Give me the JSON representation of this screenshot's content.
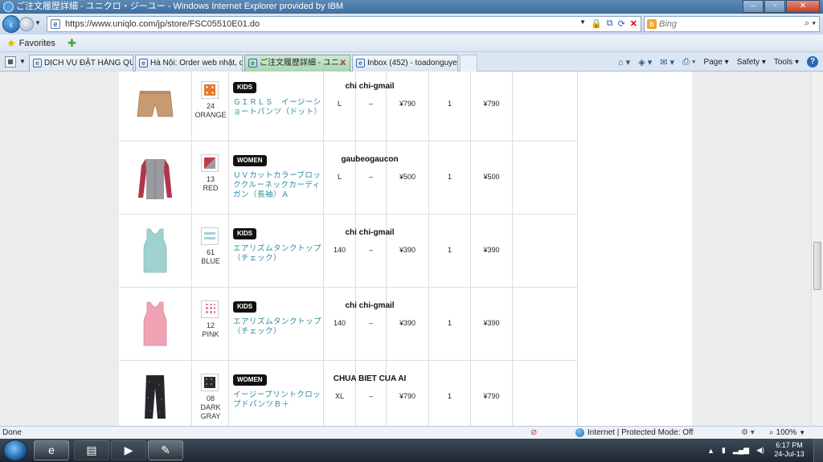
{
  "window": {
    "title": "ご注文履歴詳細 - ユニクロ・ジーユー - Windows Internet Explorer provided by IBM"
  },
  "address": {
    "url": "https://www.uniqlo.com/jp/store/FSC05510E01.do"
  },
  "search": {
    "placeholder": "Bing"
  },
  "favorites": {
    "label": "Favorites"
  },
  "tabs": [
    {
      "label": "DỊCH VỤ ĐẶT HÀNG QUỐ..."
    },
    {
      "label": "Hà Nội: Order web nhật, c..."
    },
    {
      "label": "ご注文履歴詳細 - ユニ..."
    },
    {
      "label": "Inbox (452) - toadonguyen..."
    }
  ],
  "commandbar": {
    "page": "Page ▾",
    "safety": "Safety ▾",
    "tools": "Tools ▾"
  },
  "orders": [
    {
      "owner": "chi chi-gmail",
      "category": "KIDS",
      "color_code": "24",
      "color_name": "ORANGE",
      "name": "ＧＩＲＬＳ　イージーショートパンツ（ドット）",
      "size": "L",
      "length": "–",
      "price": "¥790",
      "qty": "1",
      "total": "¥790"
    },
    {
      "owner": "gaubeogaucon",
      "category": "WOMEN",
      "color_code": "13",
      "color_name": "RED",
      "name": "ＵＶカットカラーブロッククルーネックカーディガン（長袖）Ａ",
      "size": "L",
      "length": "–",
      "price": "¥500",
      "qty": "1",
      "total": "¥500"
    },
    {
      "owner": "chi chi-gmail",
      "category": "KIDS",
      "color_code": "61",
      "color_name": "BLUE",
      "name": "エアリズムタンクトップ（チェック）",
      "size": "140",
      "length": "–",
      "price": "¥390",
      "qty": "1",
      "total": "¥390"
    },
    {
      "owner": "chi chi-gmail",
      "category": "KIDS",
      "color_code": "12",
      "color_name": "PINK",
      "name": "エアリズムタンクトップ（チェック）",
      "size": "140",
      "length": "–",
      "price": "¥390",
      "qty": "1",
      "total": "¥390"
    },
    {
      "owner": "CHUA BIET CUA AI",
      "category": "WOMEN",
      "color_code": "08",
      "color_name": "DARK GRAY",
      "name": "イージープリントクロップドパンツＢ＋",
      "size": "XL",
      "length": "–",
      "price": "¥790",
      "qty": "1",
      "total": "¥790"
    }
  ],
  "colors": {
    "orange_swatch": "#e07a2c",
    "red_swatch": "#c43a44",
    "blue_swatch": "#9ed3d8",
    "pink_swatch": "#ee8aa4",
    "gray_swatch": "#2b2b2b",
    "shorts": "#c99a72",
    "cardigan_body": "#9a9ba0",
    "cardigan_sleeve": "#b3344a",
    "tank_blue": "#9fd2cf",
    "tank_pink": "#f0a3b4",
    "pants": "#26262a",
    "name_link": "#2a8a9e"
  },
  "statusbar": {
    "text": "Done",
    "zone": "Internet | Protected Mode: Off",
    "zoom": "100%"
  },
  "taskbar": {
    "time": "6:17 PM",
    "date": "24-Jul-13"
  }
}
